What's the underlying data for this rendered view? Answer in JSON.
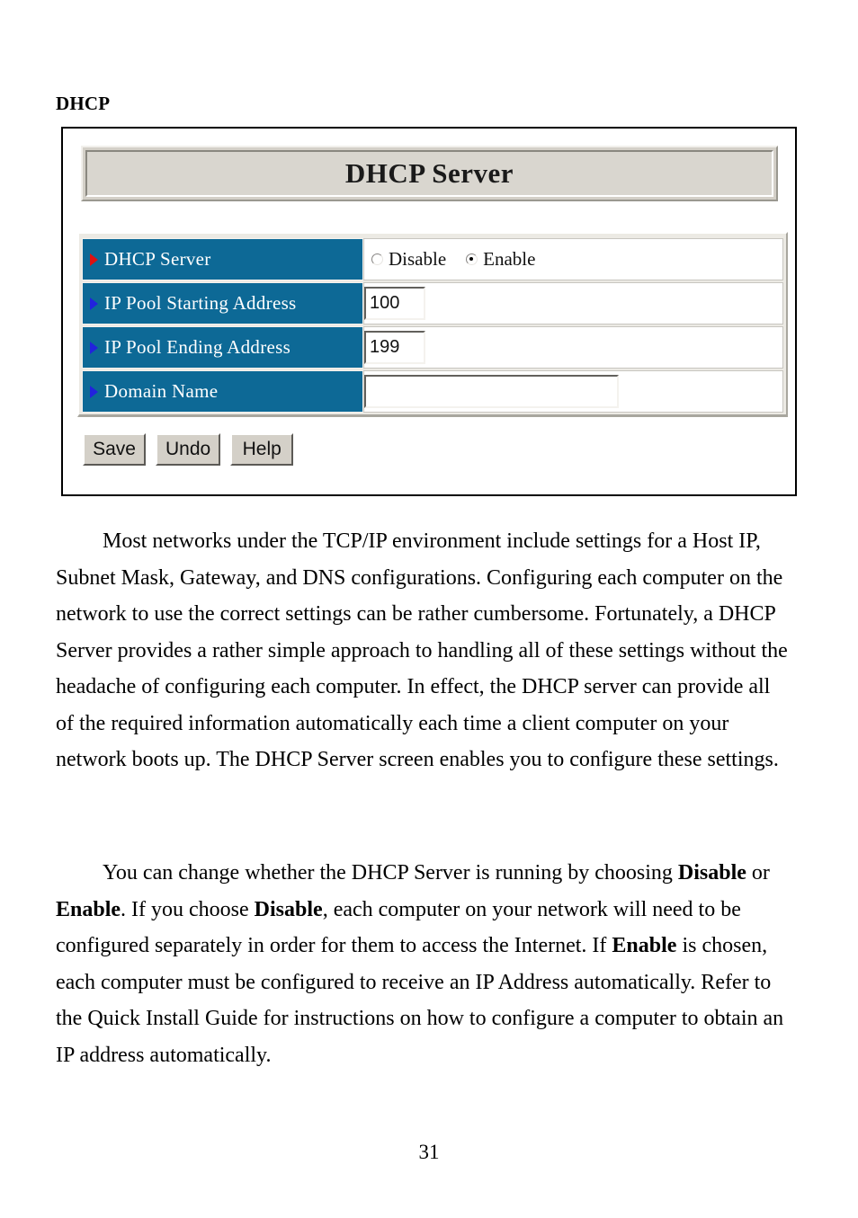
{
  "document": {
    "section_heading": "DHCP",
    "page_number": "31"
  },
  "screenshot": {
    "title": "DHCP Server",
    "rows": [
      {
        "arrow_icon": "triangle-right-icon",
        "arrow_color": "#dd1111",
        "label": "DHCP Server",
        "control": "radio",
        "options": [
          {
            "label": "Disable",
            "selected": false
          },
          {
            "label": "Enable",
            "selected": true
          }
        ]
      },
      {
        "arrow_icon": "triangle-right-icon",
        "arrow_color": "#2222dd",
        "label": "IP Pool Starting Address",
        "control": "textbox",
        "value": "100",
        "placeholder": ""
      },
      {
        "arrow_icon": "triangle-right-icon",
        "arrow_color": "#2222dd",
        "label": "IP Pool Ending Address",
        "control": "textbox",
        "value": "199",
        "placeholder": ""
      },
      {
        "arrow_icon": "triangle-right-icon",
        "arrow_color": "#2222dd",
        "label": "Domain Name",
        "control": "textbox",
        "value": "",
        "placeholder": ""
      }
    ],
    "buttons": [
      {
        "label": "Save"
      },
      {
        "label": "Undo"
      },
      {
        "label": "Help"
      }
    ],
    "colors": {
      "label_background": "#0d6996",
      "label_text": "#ffffff",
      "panel_face": "#d4d0c8",
      "arrow_primary": "#dd1111",
      "arrow_secondary": "#2222dd"
    }
  },
  "body": {
    "paragraph1": {
      "text": "Most networks under the TCP/IP environment include settings for a Host IP, Subnet Mask, Gateway, and DNS configurations. Configuring each computer on the network to use the correct settings can be rather cumbersome. Fortunately, a DHCP Server provides a rather simple approach to handling all of these settings without the headache of configuring each computer. In effect, the DHCP server can provide all of the required information automatically each time a client computer on your network boots up. The DHCP Server screen enables you to configure these settings."
    },
    "paragraph2": {
      "part1": "You can change whether the DHCP Server is running by choosing ",
      "bold1": "Disable",
      "part2": " or ",
      "bold2": "Enable",
      "part3": ". If you choose ",
      "bold3": "Disable",
      "part4": ", each computer on your network will need to be configured separately in order for them to access the Internet. If ",
      "bold4": "Enable",
      "part5": " is chosen, each computer must be configured to receive an IP Address automatically. Refer to the Quick Install Guide for instructions on how to configure a computer to obtain an IP address automatically."
    }
  }
}
